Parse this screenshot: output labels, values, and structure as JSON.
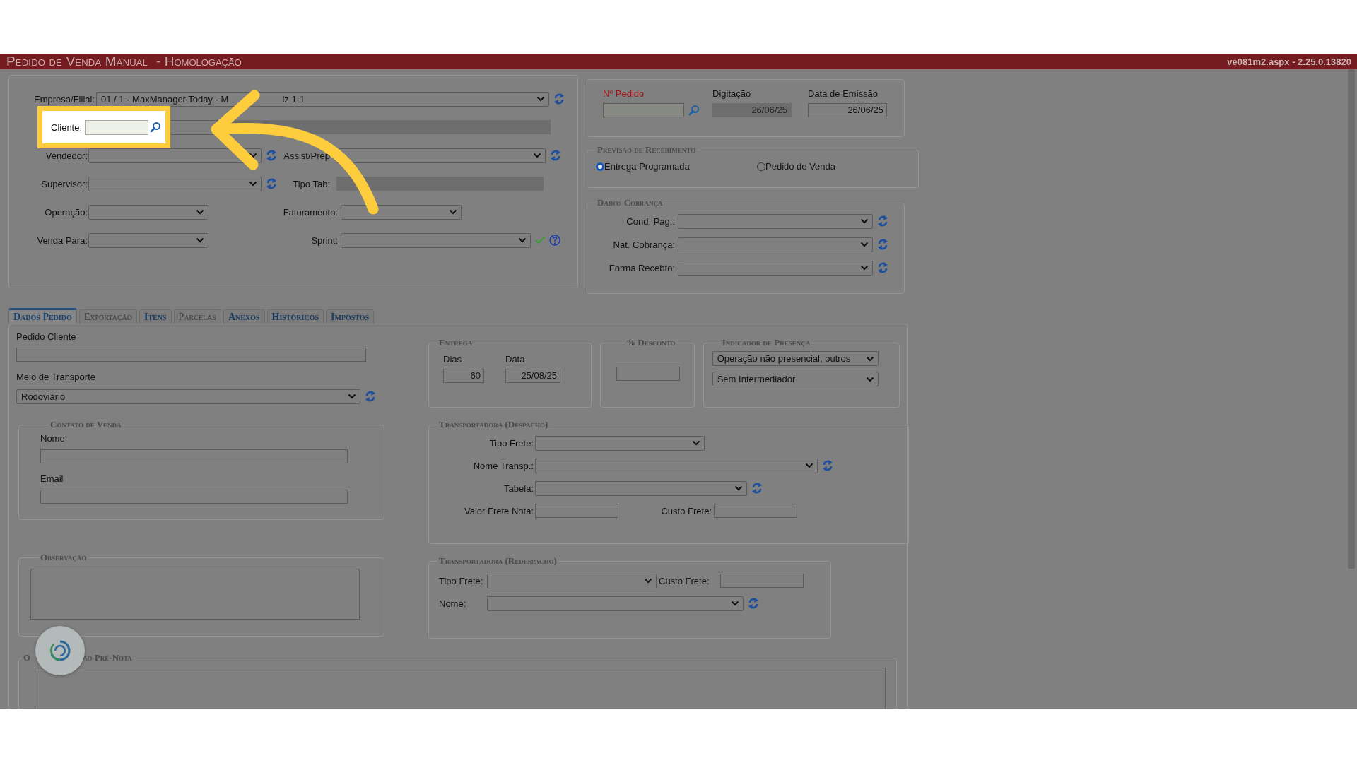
{
  "app_header": {
    "title": "Pedido de Venda Manual",
    "environment": "- Homologação",
    "version": "ve081m2.aspx - 2.25.0.13820"
  },
  "main_fields": {
    "empresa": {
      "label": "Empresa/Filial:",
      "value_start": "01 / 1 - MaxManager Today - M",
      "value_end": "iz 1-1"
    },
    "cliente": {
      "label": "Cliente:"
    },
    "vendedor": {
      "label": "Vendedor:"
    },
    "assist": {
      "label": "Assist/Prep"
    },
    "supervisor": {
      "label": "Supervisor:"
    },
    "tipo_tab": {
      "label": "Tipo Tab:"
    },
    "operacao": {
      "label": "Operação:"
    },
    "faturamento": {
      "label": "Faturamento:"
    },
    "venda_para": {
      "label": "Venda Para:"
    },
    "sprint": {
      "label": "Sprint:"
    }
  },
  "pedido": {
    "numero_label": "Nº Pedido",
    "digitacao_label": "Digitação",
    "digitacao_value": "26/06/25",
    "emissao_label": "Data de Emissão",
    "emissao_value": "26/06/25"
  },
  "previsao": {
    "title": "Previsão de Recebimento",
    "options": [
      {
        "label": "Entrega Programada",
        "selected": true
      },
      {
        "label": "Pedido de Venda",
        "selected": false
      }
    ]
  },
  "cobranca": {
    "title": "Dados Cobrança",
    "fields": [
      {
        "label": "Cond. Pag.:"
      },
      {
        "label": "Nat. Cobrança:"
      },
      {
        "label": "Forma Recebto:"
      }
    ]
  },
  "tabs": [
    {
      "label": "Dados Pedido",
      "selected": true,
      "disabled": false
    },
    {
      "label": "Exportação",
      "selected": false,
      "disabled": true
    },
    {
      "label": "Itens",
      "selected": false,
      "disabled": false
    },
    {
      "label": "Parcelas",
      "selected": false,
      "disabled": true
    },
    {
      "label": "Anexos",
      "selected": false,
      "disabled": false
    },
    {
      "label": "Históricos",
      "selected": false,
      "disabled": false
    },
    {
      "label": "Impostos",
      "selected": false,
      "disabled": false
    }
  ],
  "dados_pedido": {
    "pedido_cliente_label": "Pedido Cliente",
    "meio_transporte_label": "Meio de Transporte",
    "meio_transporte_value": "Rodoviário",
    "contato": {
      "title": "Contato de Venda",
      "nome_label": "Nome",
      "email_label": "Email"
    },
    "observacao": {
      "title": "Observação"
    },
    "pre_nota": {
      "title_start": "O",
      "title_end": "ão Pré-Nota"
    },
    "entrega": {
      "title": "Entrega",
      "dias_label": "Dias",
      "dias_value": "60",
      "data_label": "Data",
      "data_value": "25/08/25"
    },
    "desconto": {
      "title": "% Desconto"
    },
    "presenca": {
      "title": "Indicador de Presença",
      "values": [
        "Operação não presencial, outros",
        "Sem Intermediador"
      ]
    },
    "despacho": {
      "title": "Transportadora (Despacho)",
      "tipo_frete_label": "Tipo Frete:",
      "nome_transp_label": "Nome Transp.:",
      "tabela_label": "Tabela:",
      "valor_frete_label": "Valor Frete Nota:",
      "custo_frete_label": "Custo Frete:"
    },
    "redespacho": {
      "title": "Transportadora (Redespacho)",
      "tipo_frete_label": "Tipo Frete:",
      "custo_frete_label": "Custo Frete:",
      "nome_label": "Nome:"
    }
  }
}
